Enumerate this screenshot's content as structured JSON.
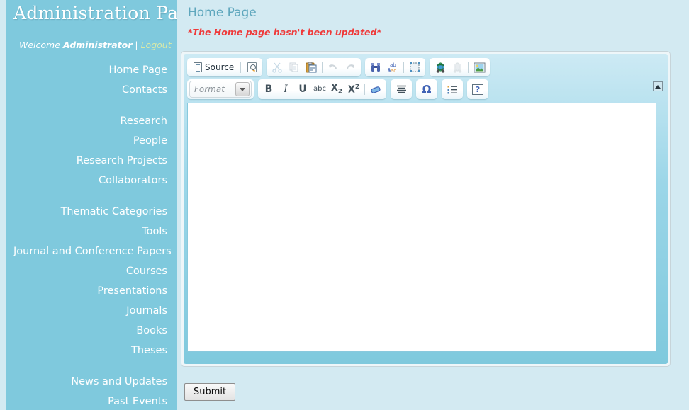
{
  "sidebar": {
    "panel_title": "Administration Panel",
    "welcome": {
      "prefix": "Welcome",
      "admin_name": "Administrator",
      "separator": "|",
      "logout_label": "Logout"
    },
    "menu_groups": [
      {
        "items": [
          {
            "label": "Home Page",
            "name": "sidebar-item-home-page"
          },
          {
            "label": "Contacts",
            "name": "sidebar-item-contacts"
          }
        ]
      },
      {
        "items": [
          {
            "label": "Research",
            "name": "sidebar-item-research"
          },
          {
            "label": "People",
            "name": "sidebar-item-people"
          },
          {
            "label": "Research Projects",
            "name": "sidebar-item-research-projects"
          },
          {
            "label": "Collaborators",
            "name": "sidebar-item-collaborators"
          }
        ]
      },
      {
        "items": [
          {
            "label": "Thematic Categories",
            "name": "sidebar-item-thematic-categories"
          },
          {
            "label": "Tools",
            "name": "sidebar-item-tools"
          },
          {
            "label": "Journal and Conference Papers",
            "name": "sidebar-item-journal-and-conference-papers"
          },
          {
            "label": "Courses",
            "name": "sidebar-item-courses"
          },
          {
            "label": "Presentations",
            "name": "sidebar-item-presentations"
          },
          {
            "label": "Journals",
            "name": "sidebar-item-journals"
          },
          {
            "label": "Books",
            "name": "sidebar-item-books"
          },
          {
            "label": "Theses",
            "name": "sidebar-item-theses"
          }
        ]
      },
      {
        "items": [
          {
            "label": "News and Updates",
            "name": "sidebar-item-news-and-updates"
          },
          {
            "label": "Past Events",
            "name": "sidebar-item-past-events"
          }
        ]
      }
    ]
  },
  "main": {
    "page_title": "Home Page",
    "status_message": "*The Home page hasn't been updated*",
    "submit_label": "Submit"
  },
  "editor": {
    "toolbar_row1": [
      {
        "name": "source-button",
        "label": "Source",
        "icon": "source-document-icon",
        "disabled": false
      },
      {
        "name": "preview-button",
        "label": "",
        "icon": "preview-magnifier-icon",
        "disabled": false
      },
      {
        "name": "cut-button",
        "label": "",
        "icon": "scissors-icon",
        "disabled": true
      },
      {
        "name": "copy-button",
        "label": "",
        "icon": "copy-pages-icon",
        "disabled": true
      },
      {
        "name": "paste-button",
        "label": "",
        "icon": "clipboard-paste-icon",
        "disabled": false
      },
      {
        "name": "undo-button",
        "label": "",
        "icon": "undo-arrow-icon",
        "disabled": true
      },
      {
        "name": "redo-button",
        "label": "",
        "icon": "redo-arrow-icon",
        "disabled": true
      },
      {
        "name": "find-button",
        "label": "",
        "icon": "binoculars-find-icon",
        "disabled": false
      },
      {
        "name": "replace-button",
        "label": "",
        "icon": "ab-ac-replace-icon",
        "disabled": false
      },
      {
        "name": "select-all-button",
        "label": "",
        "icon": "select-all-dashed-box-icon",
        "disabled": false
      },
      {
        "name": "link-button",
        "label": "",
        "icon": "globe-link-icon",
        "disabled": false
      },
      {
        "name": "unlink-button",
        "label": "",
        "icon": "globe-unlink-icon",
        "disabled": true
      },
      {
        "name": "image-button",
        "label": "",
        "icon": "picture-image-icon",
        "disabled": false
      }
    ],
    "format_select": {
      "name": "format-dropdown",
      "value": "",
      "placeholder": "Format"
    },
    "toolbar_row2": [
      {
        "name": "bold-button",
        "label": "B",
        "icon": "bold-icon"
      },
      {
        "name": "italic-button",
        "label": "I",
        "icon": "italic-icon"
      },
      {
        "name": "underline-button",
        "label": "U",
        "icon": "underline-icon"
      },
      {
        "name": "strikethrough-button",
        "label": "abc",
        "icon": "strikethrough-icon"
      },
      {
        "name": "subscript-button",
        "label": "X",
        "sub": "2",
        "icon": "subscript-icon"
      },
      {
        "name": "superscript-button",
        "label": "X",
        "sup": "2",
        "icon": "superscript-icon"
      },
      {
        "name": "remove-format-button",
        "label": "",
        "icon": "eraser-icon"
      },
      {
        "name": "justify-button",
        "label": "",
        "icon": "justify-align-icon"
      },
      {
        "name": "special-char-button",
        "label": "Ω",
        "icon": "omega-special-character-icon"
      },
      {
        "name": "bulleted-list-button",
        "label": "",
        "icon": "bulleted-list-icon"
      },
      {
        "name": "about-button",
        "label": "?",
        "icon": "help-question-icon"
      }
    ],
    "collapse_toolbar": {
      "name": "collapse-toolbar-button",
      "icon": "chevron-up-icon"
    },
    "content": ""
  },
  "colors": {
    "sidebar_bg": "#7fc9dd",
    "page_bg": "#d3eaf2",
    "title_text": "#5fa7bd",
    "error_text": "#ef3a3a",
    "logout_link": "#d9e9a8",
    "editor_chrome": "#9bd6e8"
  }
}
